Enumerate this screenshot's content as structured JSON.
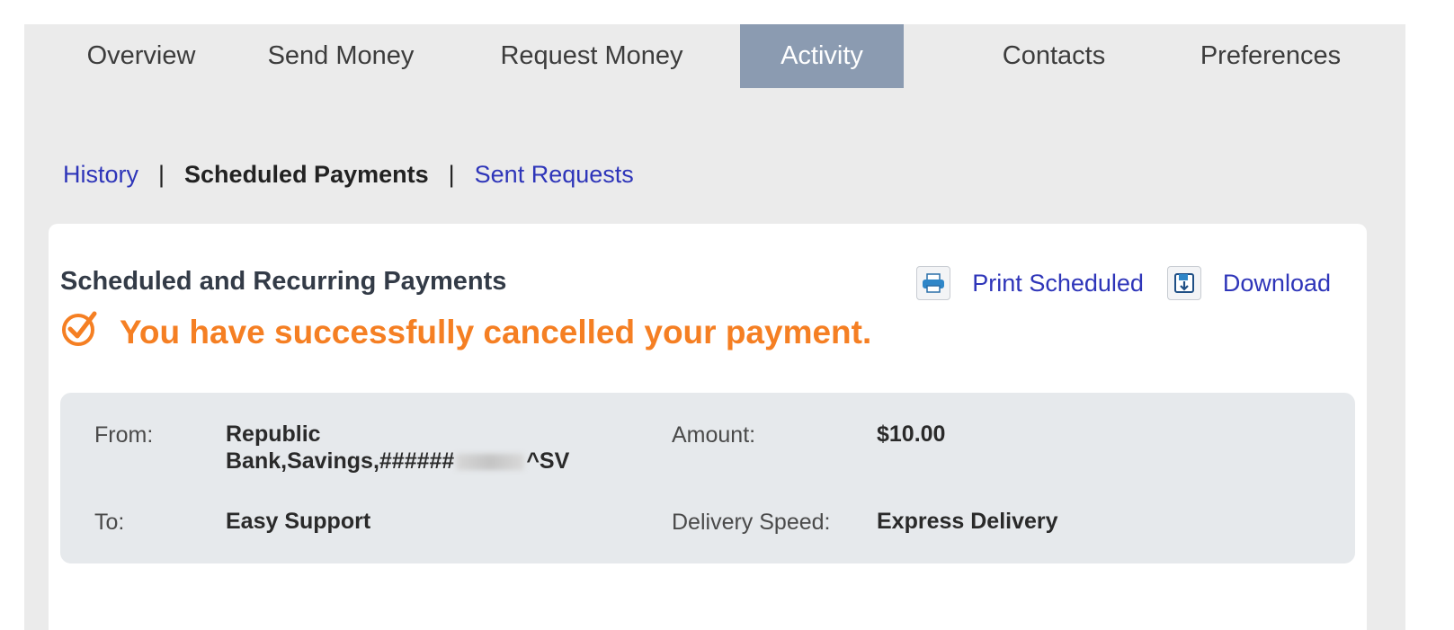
{
  "topnav": {
    "tabs": [
      {
        "label": "Overview"
      },
      {
        "label": "Send Money"
      },
      {
        "label": "Request Money"
      },
      {
        "label": "Activity"
      },
      {
        "label": "Contacts"
      },
      {
        "label": "Preferences"
      }
    ],
    "active": "Activity"
  },
  "subnav": {
    "history": "History",
    "scheduled": "Scheduled Payments",
    "sent": "Sent Requests",
    "separator": "|"
  },
  "panel": {
    "title": "Scheduled and Recurring Payments",
    "print_label": "Print Scheduled",
    "download_label": "Download",
    "success_message": "You have successfully cancelled your payment."
  },
  "details": {
    "from_label": "From:",
    "from_line1": "Republic",
    "from_line2_prefix": "Bank,Savings,######",
    "from_line2_suffix": "^SV",
    "to_label": "To:",
    "to_value": "Easy Support",
    "amount_label": "Amount:",
    "amount_value": "$10.00",
    "speed_label": "Delivery Speed:",
    "speed_value": "Express Delivery"
  },
  "colors": {
    "accent_orange": "#f57f23",
    "link_blue": "#2e35b9",
    "active_tab": "#8b9bb1"
  },
  "icons": {
    "print": "printer-icon",
    "download": "download-icon",
    "success": "check-circle-icon"
  }
}
